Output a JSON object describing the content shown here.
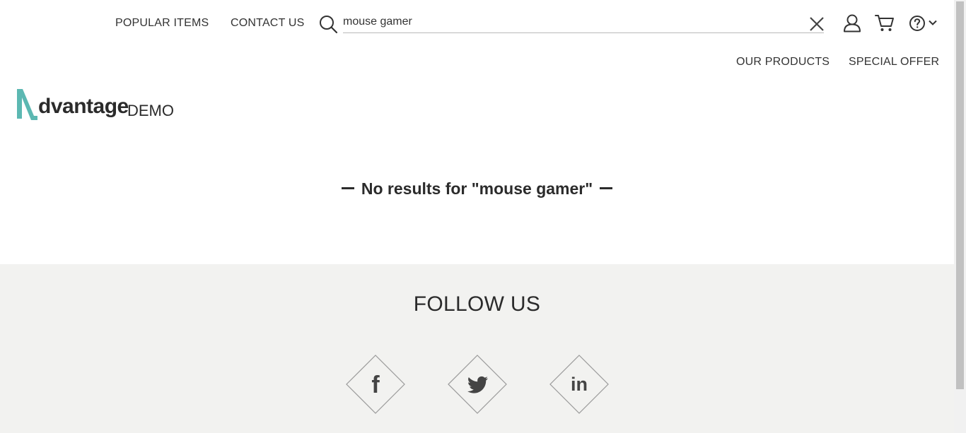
{
  "header": {
    "nav_left": [
      {
        "label": "POPULAR ITEMS"
      },
      {
        "label": "CONTACT US"
      }
    ],
    "search": {
      "value": "mouse gamer",
      "icon": "search-icon",
      "clear_icon": "close-icon"
    },
    "icons": {
      "user": "user-icon",
      "cart": "cart-icon",
      "help": "help-icon",
      "help_chevron": "chevron-down-icon"
    },
    "nav_right": [
      {
        "label": "OUR PRODUCTS"
      },
      {
        "label": "SPECIAL OFFER"
      }
    ]
  },
  "logo": {
    "main": "dvantage",
    "sub": "DEMO",
    "accent_color": "#5cb8b2"
  },
  "main": {
    "no_results": "No results for \"mouse gamer\""
  },
  "footer": {
    "follow_title": "FOLLOW US",
    "social": [
      {
        "name": "facebook-icon",
        "glyph": "f"
      },
      {
        "name": "twitter-icon"
      },
      {
        "name": "linkedin-icon",
        "glyph": "in"
      }
    ],
    "background": "#f2f2f0"
  }
}
